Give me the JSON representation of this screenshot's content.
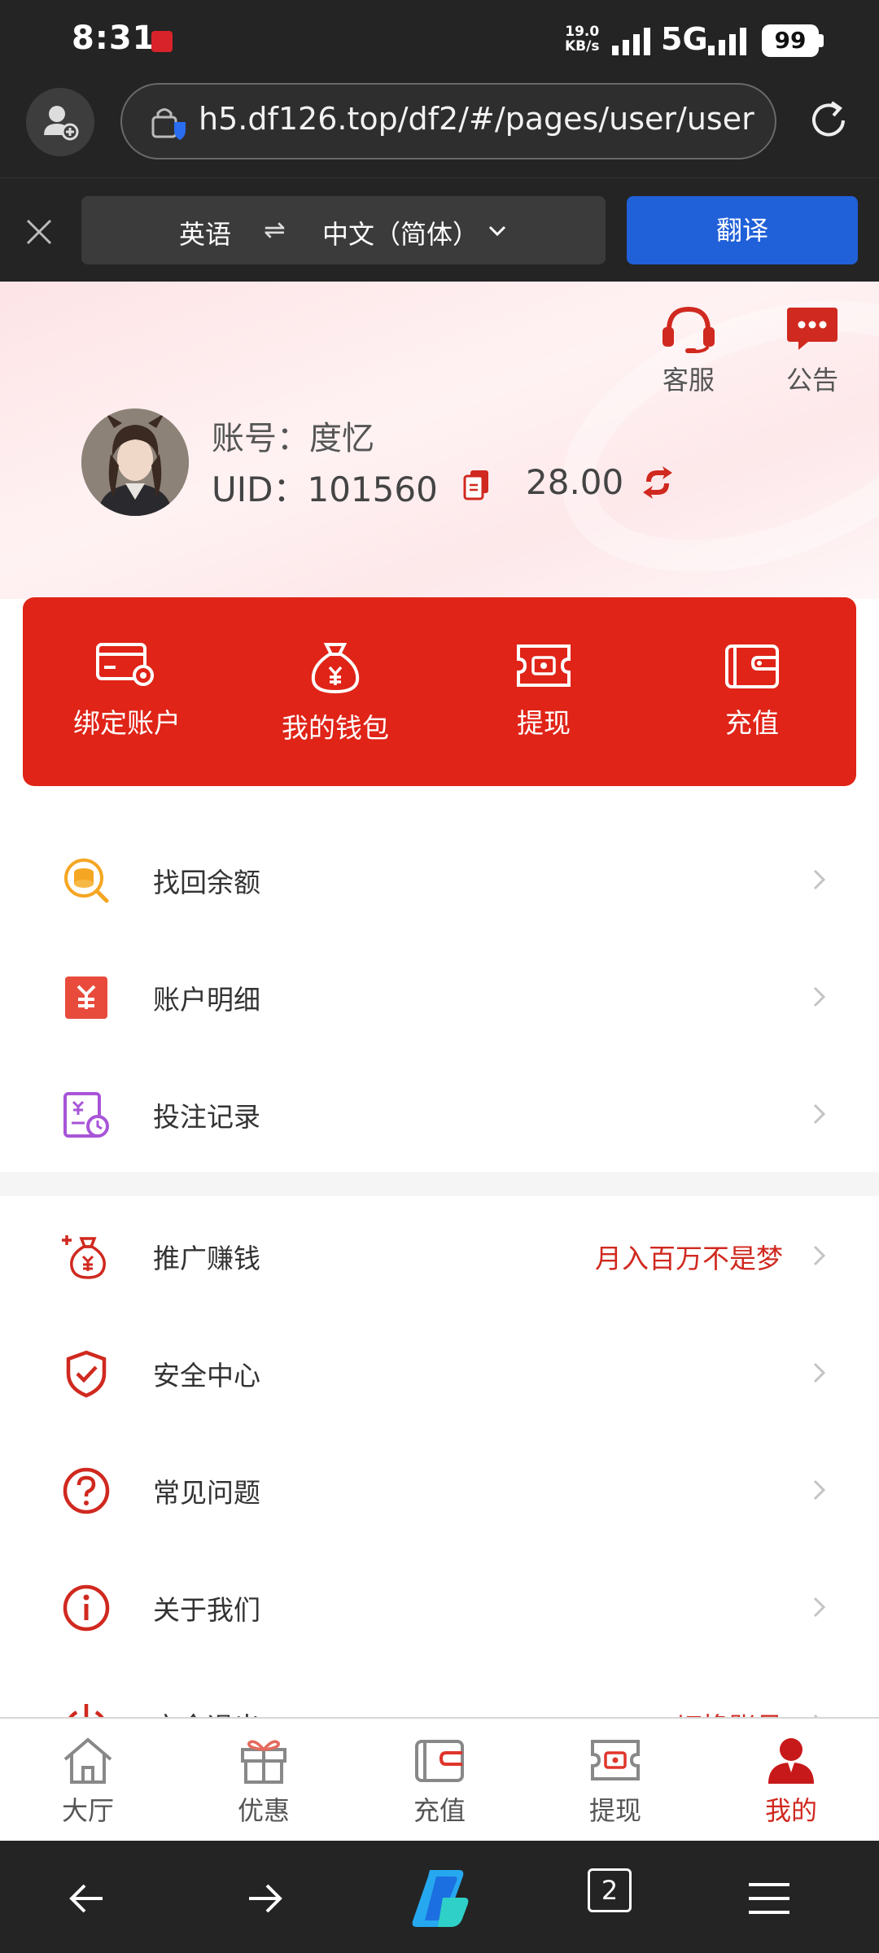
{
  "status_bar": {
    "time": "8:31",
    "net_speed_value": "19.0",
    "net_speed_unit": "KB/s",
    "network": "5G",
    "battery": "99"
  },
  "browser": {
    "url": "h5.df126.top/df2/#/pages/user/user",
    "translate": {
      "source_lang": "英语",
      "swap_symbol": "⇌",
      "target_lang": "中文（简体）",
      "button": "翻译"
    },
    "tab_count": "2"
  },
  "profile": {
    "customer_service": "客服",
    "notice": "公告",
    "account_label": "账号：",
    "account_name": "度忆",
    "uid_label": "UID：",
    "uid": "101560",
    "balance": "28.00"
  },
  "actions": [
    {
      "label": "绑定账户",
      "icon": "card-settings-icon"
    },
    {
      "label": "我的钱包",
      "icon": "money-bag-icon"
    },
    {
      "label": "提现",
      "icon": "withdraw-ticket-icon"
    },
    {
      "label": "充值",
      "icon": "wallet-icon"
    }
  ],
  "menu_group_1": [
    {
      "label": "找回余额",
      "icon": "coin-search-icon"
    },
    {
      "label": "账户明细",
      "icon": "yen-ledger-icon"
    },
    {
      "label": "投注记录",
      "icon": "bet-record-icon"
    }
  ],
  "menu_group_2": [
    {
      "label": "推广赚钱",
      "icon": "money-bag-plus-icon",
      "extra": "月入百万不是梦"
    },
    {
      "label": "安全中心",
      "icon": "shield-check-icon"
    },
    {
      "label": "常见问题",
      "icon": "question-icon"
    },
    {
      "label": "关于我们",
      "icon": "info-icon"
    },
    {
      "label": "安全退出",
      "icon": "power-icon",
      "extra": "切换账号"
    }
  ],
  "tabs": [
    {
      "label": "大厅",
      "icon": "home-icon"
    },
    {
      "label": "优惠",
      "icon": "gift-icon"
    },
    {
      "label": "充值",
      "icon": "wallet-icon"
    },
    {
      "label": "提现",
      "icon": "withdraw-ticket-icon"
    },
    {
      "label": "我的",
      "icon": "user-icon",
      "active": true
    }
  ],
  "colors": {
    "brand_red": "#e02418",
    "accent_red": "#d0291f",
    "translate_blue": "#2060d8",
    "chrome_dark": "#242424"
  }
}
